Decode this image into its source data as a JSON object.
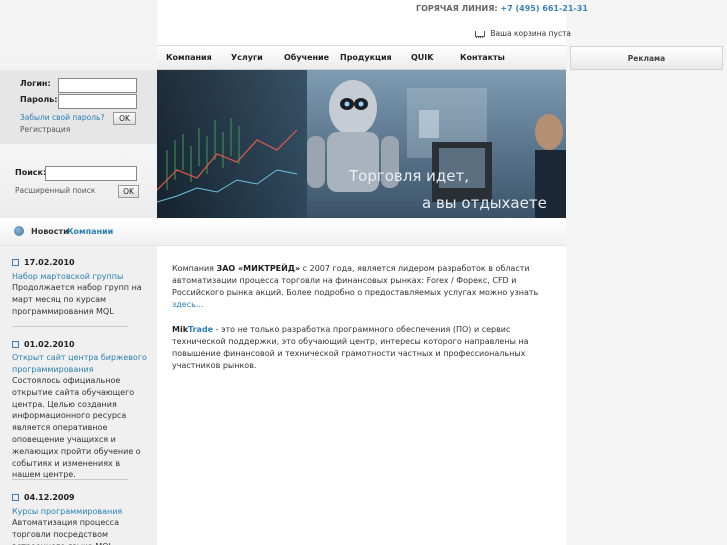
{
  "header": {
    "hotline_label": "ГОРЯЧАЯ ЛИНИЯ:",
    "phone": "+7 (495) 661-21-31",
    "cart_text": "Ваша корзина пуста"
  },
  "nav": [
    "Компания",
    "Услуги",
    "Обучение",
    "Продукция",
    "QUIK",
    "Контакты"
  ],
  "ad_label": "Реклама",
  "login": {
    "login_label": "Логин:",
    "password_label": "Пароль:",
    "forgot": "Забыли свой пароль?",
    "register": "Регистрация",
    "ok": "OK"
  },
  "search": {
    "label": "Поиск:",
    "advanced": "Расширенный поиск",
    "ok": "OK"
  },
  "banner": {
    "line1": "Торговля идет,",
    "line2": "а вы отдыхаете"
  },
  "news_header": {
    "prefix": "Новости",
    "company": "Компании"
  },
  "news": [
    {
      "date": "17.02.2010",
      "title": "Набор мартовской группы",
      "body": "Продолжается набор групп на март месяц по курсам программирования MQL"
    },
    {
      "date": "01.02.2010",
      "title": "Открыт сайт центра биржевого программирования",
      "body": "Состоялось официальное открытие сайта обучающего центра. Целью создания информационного ресурса является оперативное оповещение учащихся и желающих пройти обучение о событиях и изменениях в нашем центре."
    },
    {
      "date": "04.12.2009",
      "title": "Курсы программирования",
      "body": "Автоматизация процесса торговли посредством встроенного языка MQL"
    }
  ],
  "content": {
    "p1_start": "Компания ",
    "p1_company": "ЗАО «МИКТРЕЙД»",
    "p1_rest": " с 2007 года, является лидером разработок в области автоматизации процесса торговли на финансовых рынках: Forex / Форекс, CFD и Российского рынка акций. Более подробно о предоставляемых услугах можно узнать ",
    "p1_link": "здесь...",
    "p2_brand_a": "Mik",
    "p2_brand_b": "Trade",
    "p2_rest": " - это не только разработка программного обеспечения (ПО) и сервис технической поддержки, это обучающий центр, интересы которого направлены на повышение финансовой и технической грамотности частных и профессиональных участников рынков."
  }
}
